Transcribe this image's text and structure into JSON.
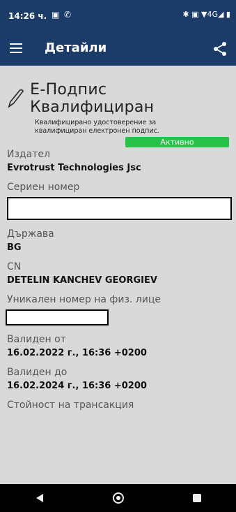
{
  "status_bar": {
    "time": "14:26 ч.",
    "right_icons_text": "✱ ▣ ▼4G◢ ▮"
  },
  "app_bar": {
    "title": "Детайли"
  },
  "certificate": {
    "title": "Е-Подпис Квалифициран",
    "description": "Квалифицирано удостоверение за квалифициран електронен подпис.",
    "status": "Активно",
    "status_color": "#27c24a"
  },
  "fields": {
    "issuer": {
      "label": "Издател",
      "value": "Evrotrust Technologies Jsc"
    },
    "serial": {
      "label": "Сериен номер"
    },
    "country": {
      "label": "Държава",
      "value": "BG"
    },
    "cn": {
      "label": "CN",
      "value": "DETELIN KANCHEV GEORGIEV"
    },
    "personal_id": {
      "label": "Уникален номер на физ. лице"
    },
    "valid_from": {
      "label": "Валиден от",
      "value": "16.02.2022 г., 16:36 +0200"
    },
    "valid_to": {
      "label": "Валиден до",
      "value": "16.02.2024 г., 16:36 +0200"
    },
    "transaction_value": {
      "label": "Стойност на трансакция"
    }
  },
  "colors": {
    "header": "#1b3b68",
    "background": "#d9d9d9"
  }
}
